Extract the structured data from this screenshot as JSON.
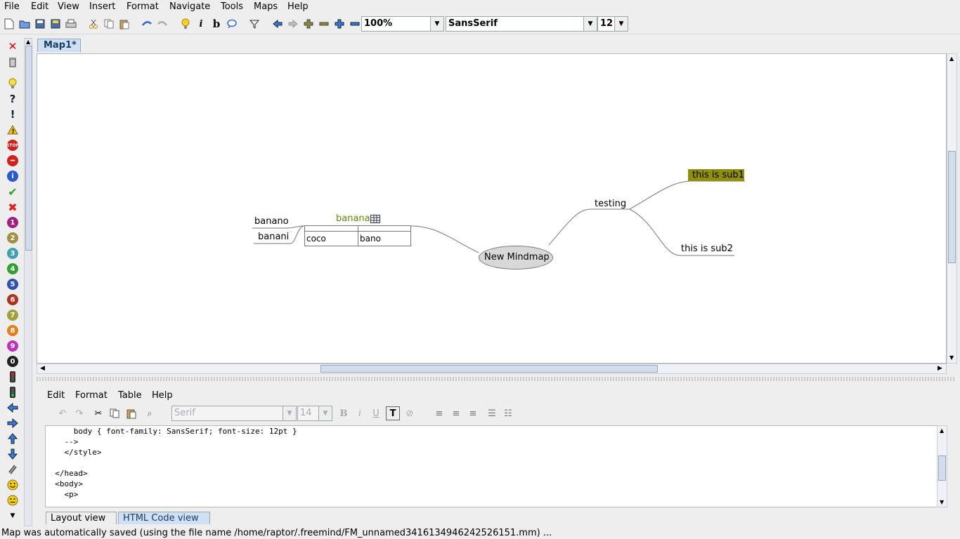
{
  "menubar": {
    "items": [
      "File",
      "Edit",
      "View",
      "Insert",
      "Format",
      "Navigate",
      "Tools",
      "Maps",
      "Help"
    ]
  },
  "toolbar": {
    "zoom": "100%",
    "font_family": "SansSerif",
    "font_size": "12"
  },
  "left_icons": [
    "close-icon",
    "trash-icon",
    "idea-icon",
    "question-icon",
    "exclamation-icon",
    "warning-icon",
    "stop-icon",
    "no-entry-icon",
    "info-icon",
    "check-icon",
    "cross-icon",
    "priority-1-icon",
    "priority-2-icon",
    "priority-3-icon",
    "priority-4-icon",
    "priority-5-icon",
    "priority-6-icon",
    "priority-7-icon",
    "priority-8-icon",
    "priority-9-icon",
    "priority-0-icon",
    "traffic-light-red-icon",
    "traffic-light-green-icon",
    "arrow-left-icon",
    "arrow-right-icon",
    "arrow-up-icon",
    "arrow-down-icon",
    "attachment-icon",
    "smiley-happy-icon",
    "smiley-neutral-icon"
  ],
  "tab": {
    "label": "Map1*"
  },
  "mindmap": {
    "root": "New Mindmap",
    "nodes": {
      "testing": "testing",
      "sub1": "this is sub1",
      "sub2": "this is sub2",
      "banana": "banana",
      "banano": "banano",
      "banani": "banani",
      "table_cells": [
        "coco",
        "bano"
      ]
    },
    "colors": {
      "sub1_bg": "#8f8f0a",
      "banana_text": "#5a8a00",
      "root_fill": "#d8d8d8"
    }
  },
  "editor": {
    "menu": [
      "Edit",
      "Format",
      "Table",
      "Help"
    ],
    "font_family": "Serif",
    "font_size": "14",
    "code_lines": [
      "      body { font-family: SansSerif; font-size: 12pt }",
      "    -->",
      "    </style>",
      "",
      "  </head>",
      "  <body>",
      "    <p>"
    ],
    "tabs": [
      "Layout view",
      "HTML Code view"
    ]
  },
  "status": "Map was automatically saved (using the file name /home/raptor/.freemind/FM_unnamed3416134946242526151.mm) ..."
}
